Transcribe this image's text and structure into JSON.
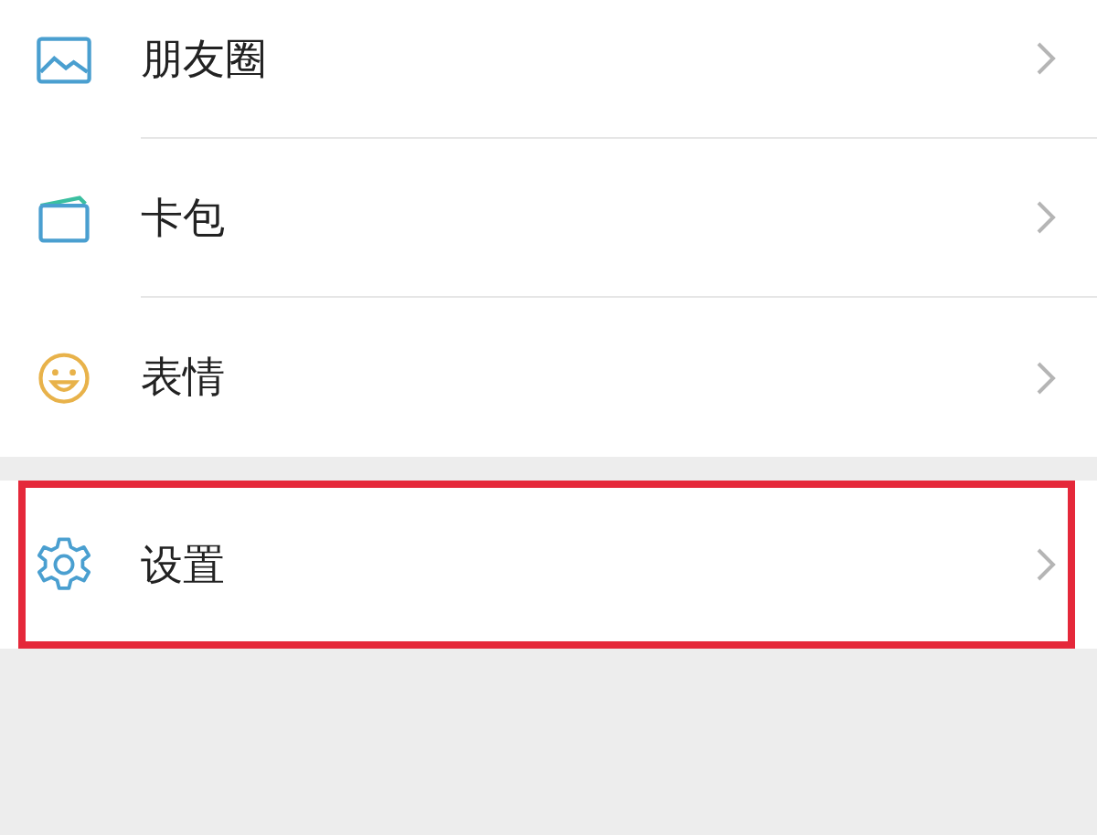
{
  "groups": [
    {
      "items": [
        {
          "kind": "moments",
          "label": "朋友圈",
          "highlighted": false
        },
        {
          "kind": "cards",
          "label": "卡包",
          "highlighted": false
        },
        {
          "kind": "stickers",
          "label": "表情",
          "highlighted": false
        }
      ]
    },
    {
      "items": [
        {
          "kind": "settings",
          "label": "设置",
          "highlighted": true
        }
      ]
    }
  ]
}
